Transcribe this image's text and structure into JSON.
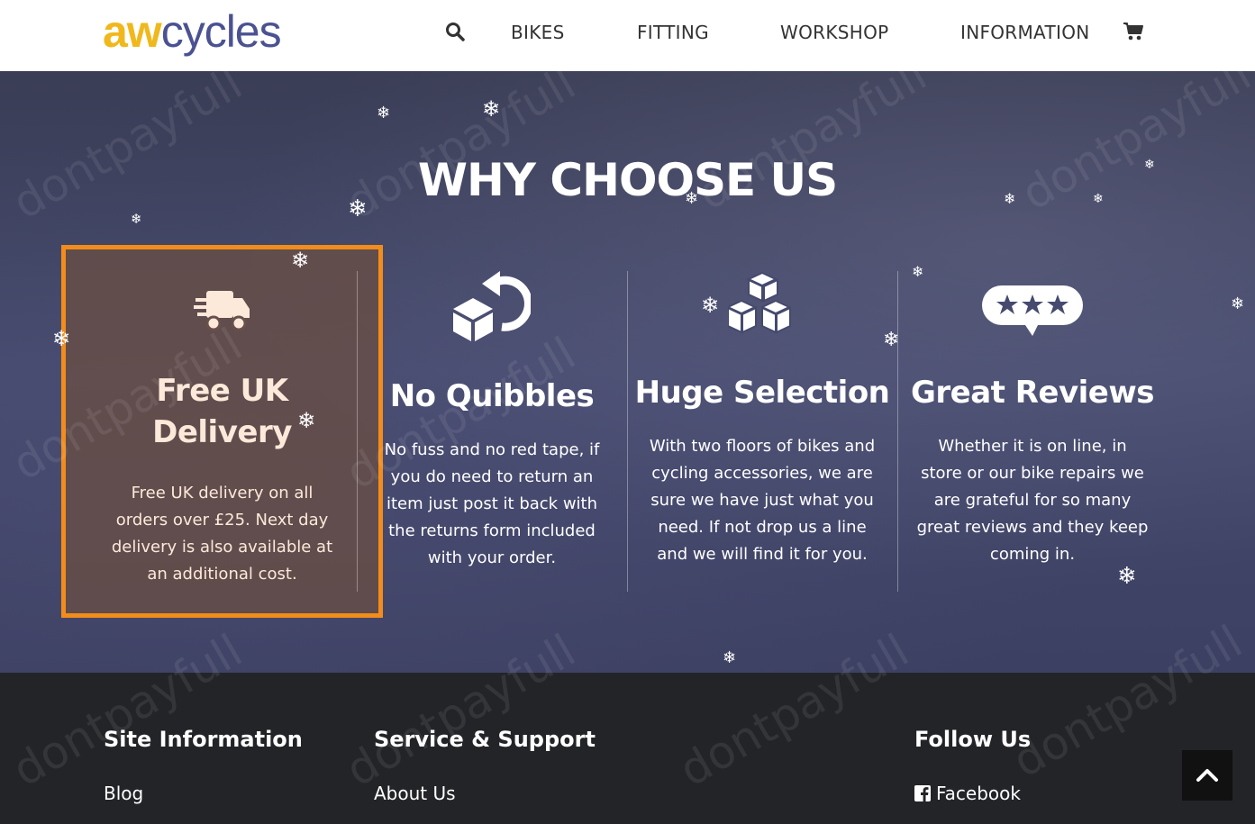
{
  "header": {
    "logo_aw": "aw",
    "logo_cycles": "cycles",
    "nav": [
      "BIKES",
      "FITTING",
      "WORKSHOP",
      "INFORMATION"
    ],
    "icons": [
      "search-icon",
      "cart-icon"
    ]
  },
  "hero": {
    "title": "WHY CHOOSE US",
    "features": [
      {
        "icon": "delivery-truck-icon",
        "title_line1": "Free UK",
        "title_line2": "Delivery",
        "body": [
          "Free UK delivery on all",
          "orders over £25. Next day",
          "delivery is also available at",
          "an additional cost."
        ]
      },
      {
        "icon": "return-box-icon",
        "title_line1": "No Quibbles",
        "body": [
          "No fuss and no red tape, if",
          "you do need to return an",
          "item just post it back with",
          "the returns form included",
          "with your order."
        ]
      },
      {
        "icon": "cubes-icon",
        "title_line1": "Huge Selection",
        "body": [
          "With two floors of bikes and",
          "cycling accessories, we are",
          "sure we have just what you",
          "need. If not drop us a line",
          "and we will find it for you."
        ]
      },
      {
        "icon": "star-rating-icon",
        "title_line1": "Great Reviews",
        "body": [
          "Whether it is on line, in",
          "store or our bike repairs we",
          "are grateful for so many",
          "great reviews and they keep",
          "coming in."
        ]
      }
    ],
    "highlight_color": "#f28c1a"
  },
  "footer": {
    "col1": {
      "heading": "Site Information",
      "link": "Blog"
    },
    "col2": {
      "heading": "Service & Support",
      "link": "About Us"
    },
    "col3": {
      "heading": "Follow Us",
      "link": "Facebook"
    }
  },
  "watermark": "dontpayfull",
  "snowflake": "❄"
}
